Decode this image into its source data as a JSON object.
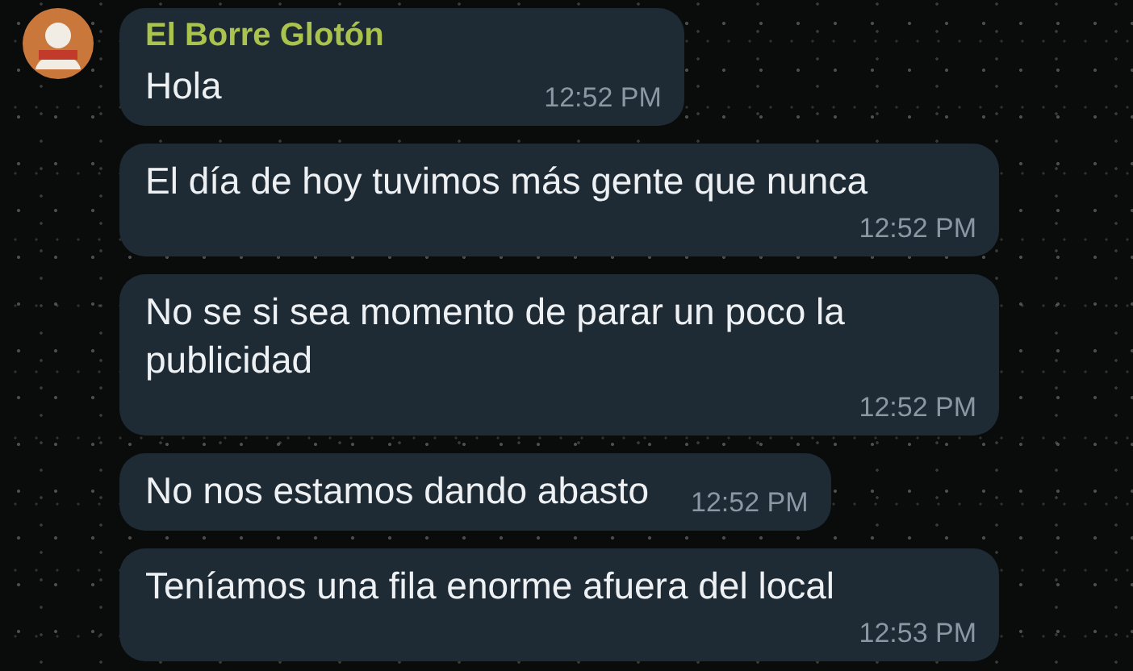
{
  "chat": {
    "sender": "El Borre Glotón",
    "messages": [
      {
        "text": "Hola",
        "time": "12:52 PM"
      },
      {
        "text": "El día de hoy tuvimos más gente que nunca",
        "time": "12:52 PM"
      },
      {
        "text": "No se si sea momento de parar un poco la publicidad",
        "time": "12:52 PM"
      },
      {
        "text": "No nos estamos dando abasto",
        "time": "12:52 PM"
      },
      {
        "text": "Teníamos una fila enorme afuera del local",
        "time": "12:53 PM"
      }
    ]
  }
}
